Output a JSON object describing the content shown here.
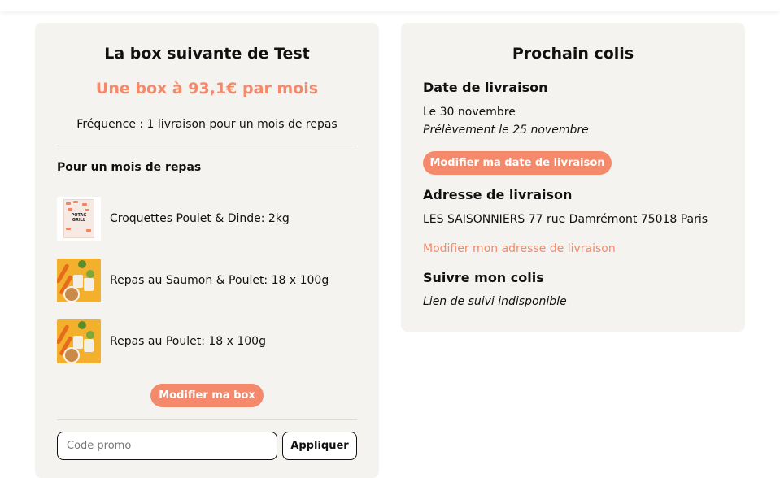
{
  "box": {
    "title": "La box suivante de Test",
    "price_text": "Une box à 93,1€ par mois",
    "frequency_text": "Fréquence : 1 livraison pour un mois de repas",
    "section_label": "Pour un mois de repas",
    "products": [
      {
        "name": "Croquettes Poulet & Dinde: 2kg",
        "image": "kibble-bag"
      },
      {
        "name": "Repas au Saumon & Poulet: 18 x 100g",
        "image": "meal-packs"
      },
      {
        "name": "Repas au Poulet: 18 x 100g",
        "image": "meal-packs"
      }
    ],
    "modify_button": "Modifier ma box",
    "promo": {
      "placeholder": "Code promo",
      "value": "",
      "apply_label": "Appliquer"
    }
  },
  "next_parcel": {
    "title": "Prochain colis",
    "delivery_date": {
      "heading": "Date de livraison",
      "date_text": "Le 30 novembre",
      "debit_text": "Prélèvement le 25 novembre",
      "modify_button": "Modifier ma date de livraison"
    },
    "address": {
      "heading": "Adresse de livraison",
      "text": "LES SAISONNIERS 77 rue Damrémont 75018 Paris",
      "modify_link": "Modifier mon adresse de livraison"
    },
    "tracking": {
      "heading": "Suivre mon colis",
      "text": "Lien de suivi indisponible"
    }
  },
  "colors": {
    "accent": "#f4896b",
    "card_background": "#f5f3ef",
    "text": "#111111"
  }
}
